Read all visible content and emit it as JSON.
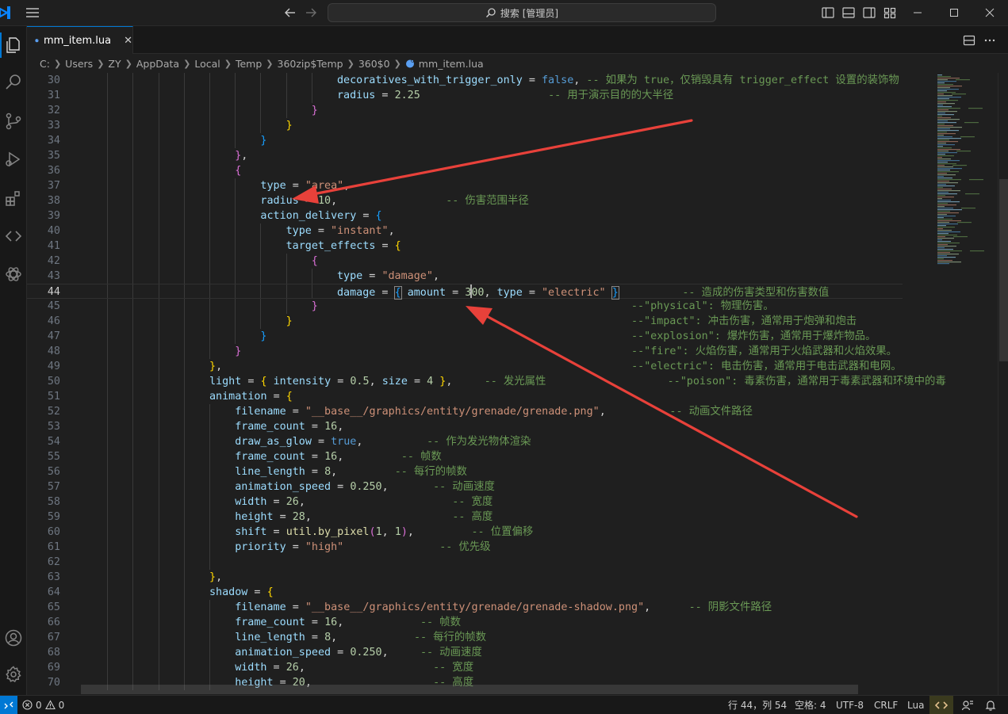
{
  "titlebar": {
    "search_text": "搜索 [管理员]"
  },
  "tab": {
    "filename": "mm_item.lua",
    "close": "✕"
  },
  "breadcrumb": [
    "C:",
    "Users",
    "ZY",
    "AppData",
    "Local",
    "Temp",
    "360zip$Temp",
    "360$0",
    "mm_item.lua"
  ],
  "editor": {
    "first_line": 30,
    "current_line": 44,
    "lines": [
      {
        "n": 30,
        "indent": 10,
        "tokens": [
          [
            "prop",
            "decoratives_with_trigger_only"
          ],
          [
            "pl",
            " = "
          ],
          [
            "kw",
            "false"
          ],
          [
            "pl",
            ", "
          ],
          [
            "cmt",
            "-- 如果为 true，仅销毁具有 trigger_effect 设置的装饰物"
          ]
        ]
      },
      {
        "n": 31,
        "indent": 10,
        "tokens": [
          [
            "prop",
            "radius"
          ],
          [
            "pl",
            " = "
          ],
          [
            "num",
            "2.25"
          ],
          [
            "pl",
            "                    "
          ],
          [
            "cmt",
            "-- 用于演示目的的大半径"
          ]
        ]
      },
      {
        "n": 32,
        "indent": 9,
        "tokens": [
          [
            "b2",
            "}"
          ]
        ]
      },
      {
        "n": 33,
        "indent": 8,
        "tokens": [
          [
            "b1",
            "}"
          ]
        ]
      },
      {
        "n": 34,
        "indent": 7,
        "tokens": [
          [
            "b3",
            "}"
          ]
        ]
      },
      {
        "n": 35,
        "indent": 6,
        "tokens": [
          [
            "b2",
            "}"
          ],
          [
            "pl",
            ","
          ]
        ]
      },
      {
        "n": 36,
        "indent": 6,
        "tokens": [
          [
            "b2",
            "{"
          ]
        ]
      },
      {
        "n": 37,
        "indent": 7,
        "tokens": [
          [
            "prop",
            "type"
          ],
          [
            "pl",
            " = "
          ],
          [
            "str",
            "\"area\""
          ],
          [
            "pl",
            ","
          ]
        ]
      },
      {
        "n": 38,
        "indent": 7,
        "tokens": [
          [
            "prop",
            "radius"
          ],
          [
            "pl",
            " = "
          ],
          [
            "num",
            "10"
          ],
          [
            "pl",
            ",                 "
          ],
          [
            "cmt",
            "-- 伤害范围半径"
          ]
        ]
      },
      {
        "n": 39,
        "indent": 7,
        "tokens": [
          [
            "prop",
            "action_delivery"
          ],
          [
            "pl",
            " = "
          ],
          [
            "b3",
            "{"
          ]
        ]
      },
      {
        "n": 40,
        "indent": 8,
        "tokens": [
          [
            "prop",
            "type"
          ],
          [
            "pl",
            " = "
          ],
          [
            "str",
            "\"instant\""
          ],
          [
            "pl",
            ","
          ]
        ]
      },
      {
        "n": 41,
        "indent": 8,
        "tokens": [
          [
            "prop",
            "target_effects"
          ],
          [
            "pl",
            " = "
          ],
          [
            "b1",
            "{"
          ]
        ]
      },
      {
        "n": 42,
        "indent": 9,
        "tokens": [
          [
            "b2",
            "{"
          ]
        ]
      },
      {
        "n": 43,
        "indent": 10,
        "tokens": [
          [
            "prop",
            "type"
          ],
          [
            "pl",
            " = "
          ],
          [
            "str",
            "\"damage\""
          ],
          [
            "pl",
            ","
          ]
        ]
      },
      {
        "n": 44,
        "indent": 10,
        "current": true,
        "tokens": [
          [
            "prop",
            "damage"
          ],
          [
            "pl",
            " = "
          ],
          [
            "b3hl",
            "{"
          ],
          [
            "pl",
            " "
          ],
          [
            "prop",
            "amount"
          ],
          [
            "pl",
            " = "
          ],
          [
            "num",
            "3"
          ],
          [
            "cursor",
            ""
          ],
          [
            "num",
            "00"
          ],
          [
            "pl",
            ", "
          ],
          [
            "prop",
            "type"
          ],
          [
            "pl",
            " = "
          ],
          [
            "str",
            "\"electric\""
          ],
          [
            "pl",
            " "
          ],
          [
            "b3hl",
            "}"
          ],
          [
            "pl",
            "          "
          ],
          [
            "cmt",
            "-- 造成的伤害类型和伤害数值"
          ]
        ]
      },
      {
        "n": 45,
        "indent": 9,
        "tokens": [
          [
            "b2",
            "}"
          ],
          [
            "pl",
            "                                                 "
          ],
          [
            "cmt",
            "--\"physical\": 物理伤害。"
          ]
        ]
      },
      {
        "n": 46,
        "indent": 8,
        "tokens": [
          [
            "b1",
            "}"
          ],
          [
            "pl",
            "                                                     "
          ],
          [
            "cmt",
            "--\"impact\": 冲击伤害，通常用于炮弹和炮击"
          ]
        ]
      },
      {
        "n": 47,
        "indent": 7,
        "tokens": [
          [
            "b3",
            "}"
          ],
          [
            "pl",
            "                                                         "
          ],
          [
            "cmt",
            "--\"explosion\": 爆炸伤害，通常用于爆炸物品。"
          ]
        ]
      },
      {
        "n": 48,
        "indent": 6,
        "tokens": [
          [
            "b2",
            "}"
          ],
          [
            "pl",
            "                                                             "
          ],
          [
            "cmt",
            "--\"fire\": 火焰伤害，通常用于火焰武器和火焰效果。"
          ]
        ]
      },
      {
        "n": 49,
        "indent": 5,
        "tokens": [
          [
            "b1",
            "}"
          ],
          [
            "pl",
            ",                                                                "
          ],
          [
            "cmt",
            "--\"electric\": 电击伤害，通常用于电击武器和电网。"
          ]
        ]
      },
      {
        "n": 50,
        "indent": 5,
        "tokens": [
          [
            "prop",
            "light"
          ],
          [
            "pl",
            " = "
          ],
          [
            "b1",
            "{"
          ],
          [
            "pl",
            " "
          ],
          [
            "prop",
            "intensity"
          ],
          [
            "pl",
            " = "
          ],
          [
            "num",
            "0.5"
          ],
          [
            "pl",
            ", "
          ],
          [
            "prop",
            "size"
          ],
          [
            "pl",
            " = "
          ],
          [
            "num",
            "4"
          ],
          [
            "pl",
            " "
          ],
          [
            "b1",
            "}"
          ],
          [
            "pl",
            ",     "
          ],
          [
            "cmt",
            "-- 发光属性"
          ],
          [
            "pl",
            "                   "
          ],
          [
            "cmt",
            "--\"poison\": 毒素伤害，通常用于毒素武器和环境中的毒"
          ]
        ]
      },
      {
        "n": 51,
        "indent": 5,
        "tokens": [
          [
            "prop",
            "animation"
          ],
          [
            "pl",
            " = "
          ],
          [
            "b1",
            "{"
          ]
        ]
      },
      {
        "n": 52,
        "indent": 6,
        "tokens": [
          [
            "prop",
            "filename"
          ],
          [
            "pl",
            " = "
          ],
          [
            "str",
            "\"__base__/graphics/entity/grenade/grenade.png\""
          ],
          [
            "pl",
            ",          "
          ],
          [
            "cmt",
            "-- 动画文件路径"
          ]
        ]
      },
      {
        "n": 53,
        "indent": 6,
        "tokens": [
          [
            "prop",
            "frame_count"
          ],
          [
            "pl",
            " = "
          ],
          [
            "num",
            "16"
          ],
          [
            "pl",
            ","
          ]
        ]
      },
      {
        "n": 54,
        "indent": 6,
        "tokens": [
          [
            "prop",
            "draw_as_glow"
          ],
          [
            "pl",
            " = "
          ],
          [
            "kw",
            "true"
          ],
          [
            "pl",
            ",          "
          ],
          [
            "cmt",
            "-- 作为发光物体渲染"
          ]
        ]
      },
      {
        "n": 55,
        "indent": 6,
        "tokens": [
          [
            "prop",
            "frame_count"
          ],
          [
            "pl",
            " = "
          ],
          [
            "num",
            "16"
          ],
          [
            "pl",
            ",         "
          ],
          [
            "cmt",
            "-- 帧数"
          ]
        ]
      },
      {
        "n": 56,
        "indent": 6,
        "tokens": [
          [
            "prop",
            "line_length"
          ],
          [
            "pl",
            " = "
          ],
          [
            "num",
            "8"
          ],
          [
            "pl",
            ",         "
          ],
          [
            "cmt",
            "-- 每行的帧数"
          ]
        ]
      },
      {
        "n": 57,
        "indent": 6,
        "tokens": [
          [
            "prop",
            "animation_speed"
          ],
          [
            "pl",
            " = "
          ],
          [
            "num",
            "0.250"
          ],
          [
            "pl",
            ",       "
          ],
          [
            "cmt",
            "-- 动画速度"
          ]
        ]
      },
      {
        "n": 58,
        "indent": 6,
        "tokens": [
          [
            "prop",
            "width"
          ],
          [
            "pl",
            " = "
          ],
          [
            "num",
            "26"
          ],
          [
            "pl",
            ",                       "
          ],
          [
            "cmt",
            "-- 宽度"
          ]
        ]
      },
      {
        "n": 59,
        "indent": 6,
        "tokens": [
          [
            "prop",
            "height"
          ],
          [
            "pl",
            " = "
          ],
          [
            "num",
            "28"
          ],
          [
            "pl",
            ",                      "
          ],
          [
            "cmt",
            "-- 高度"
          ]
        ]
      },
      {
        "n": 60,
        "indent": 6,
        "tokens": [
          [
            "prop",
            "shift"
          ],
          [
            "pl",
            " = "
          ],
          [
            "fn",
            "util.by_pixel"
          ],
          [
            "b2",
            "("
          ],
          [
            "num",
            "1"
          ],
          [
            "pl",
            ", "
          ],
          [
            "num",
            "1"
          ],
          [
            "b2",
            ")"
          ],
          [
            "pl",
            ",         "
          ],
          [
            "cmt",
            "-- 位置偏移"
          ]
        ]
      },
      {
        "n": 61,
        "indent": 6,
        "tokens": [
          [
            "prop",
            "priority"
          ],
          [
            "pl",
            " = "
          ],
          [
            "str",
            "\"high\""
          ],
          [
            "pl",
            "               "
          ],
          [
            "cmt",
            "-- 优先级"
          ]
        ]
      },
      {
        "n": 62,
        "indent": 6,
        "tokens": []
      },
      {
        "n": 63,
        "indent": 5,
        "tokens": [
          [
            "b1",
            "}"
          ],
          [
            "pl",
            ","
          ]
        ]
      },
      {
        "n": 64,
        "indent": 5,
        "tokens": [
          [
            "prop",
            "shadow"
          ],
          [
            "pl",
            " = "
          ],
          [
            "b1",
            "{"
          ]
        ]
      },
      {
        "n": 65,
        "indent": 6,
        "tokens": [
          [
            "prop",
            "filename"
          ],
          [
            "pl",
            " = "
          ],
          [
            "str",
            "\"__base__/graphics/entity/grenade/grenade-shadow.png\""
          ],
          [
            "pl",
            ",      "
          ],
          [
            "cmt",
            "-- 阴影文件路径"
          ]
        ]
      },
      {
        "n": 66,
        "indent": 6,
        "tokens": [
          [
            "prop",
            "frame_count"
          ],
          [
            "pl",
            " = "
          ],
          [
            "num",
            "16"
          ],
          [
            "pl",
            ",            "
          ],
          [
            "cmt",
            "-- 帧数"
          ]
        ]
      },
      {
        "n": 67,
        "indent": 6,
        "tokens": [
          [
            "prop",
            "line_length"
          ],
          [
            "pl",
            " = "
          ],
          [
            "num",
            "8"
          ],
          [
            "pl",
            ",            "
          ],
          [
            "cmt",
            "-- 每行的帧数"
          ]
        ]
      },
      {
        "n": 68,
        "indent": 6,
        "tokens": [
          [
            "prop",
            "animation_speed"
          ],
          [
            "pl",
            " = "
          ],
          [
            "num",
            "0.250"
          ],
          [
            "pl",
            ",     "
          ],
          [
            "cmt",
            "-- 动画速度"
          ]
        ]
      },
      {
        "n": 69,
        "indent": 6,
        "tokens": [
          [
            "prop",
            "width"
          ],
          [
            "pl",
            " = "
          ],
          [
            "num",
            "26"
          ],
          [
            "pl",
            ",                    "
          ],
          [
            "cmt",
            "-- 宽度"
          ]
        ]
      },
      {
        "n": 70,
        "indent": 6,
        "tokens": [
          [
            "prop",
            "height"
          ],
          [
            "pl",
            " = "
          ],
          [
            "num",
            "20"
          ],
          [
            "pl",
            ",                   "
          ],
          [
            "cmt",
            "-- 高度"
          ]
        ]
      }
    ]
  },
  "statusbar": {
    "problems": "0",
    "warnings": "0",
    "cursor_position": "行 44，列 54",
    "spaces": "空格: 4",
    "encoding": "UTF-8",
    "eol": "CRLF",
    "language": "Lua"
  },
  "colors": {
    "accent": "#0078d4",
    "annotation_arrow": "#e8413a"
  }
}
